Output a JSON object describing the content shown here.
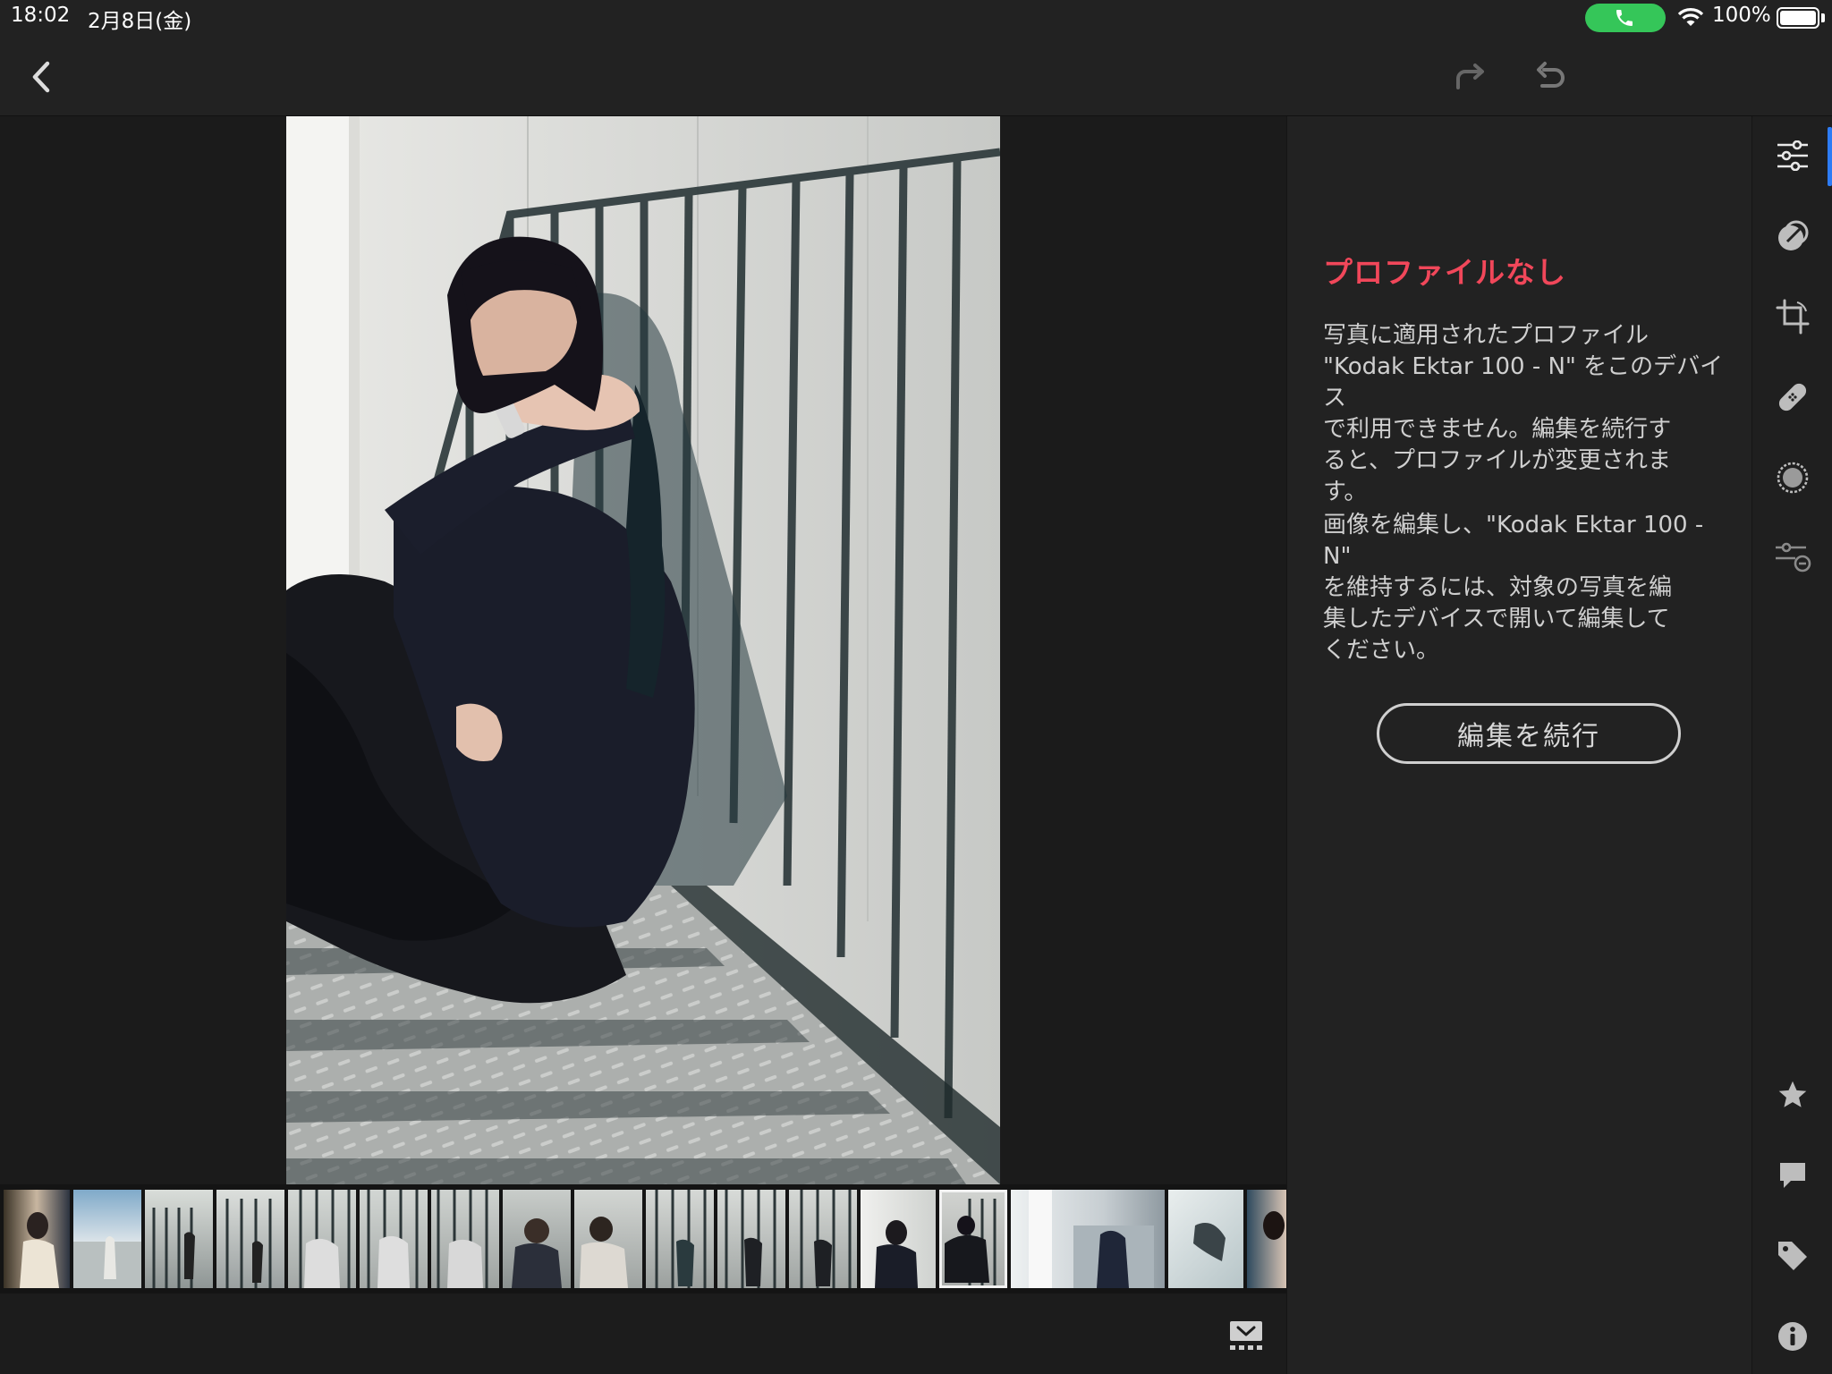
{
  "status_bar": {
    "time": "18:02",
    "date": "2月8日(金)",
    "battery": "100%",
    "call_color": "#35c659"
  },
  "toolbar": {
    "back_icon": "chevron-left-icon",
    "redo_icon": "redo-icon",
    "undo_icon": "undo-icon"
  },
  "panel": {
    "title": "プロファイルなし",
    "message1": "写真に適用されたプロファイル\n\"Kodak Ektar 100 - N\" をこのデバイス\nで利用できません。編集を続行す\nると、プロファイルが変更されま\nす。",
    "message2": "画像を編集し、\"Kodak Ektar 100 - N\"\nを維持するには、対象の写真を編\n集したデバイスで開いて編集して\nください。",
    "continue_label": "編集を続行",
    "title_color": "#f1475a"
  },
  "rail": {
    "icons": [
      "sliders-icon",
      "presets-icon",
      "crop-icon",
      "healing-icon",
      "mask-icon",
      "versions-icon",
      "star-icon",
      "comment-icon",
      "tag-icon",
      "info-icon"
    ],
    "active_color": "#2d7cf6"
  },
  "filmstrip": {
    "selected_index": 13,
    "toggle_icon": "filmstrip-toggle-icon"
  }
}
